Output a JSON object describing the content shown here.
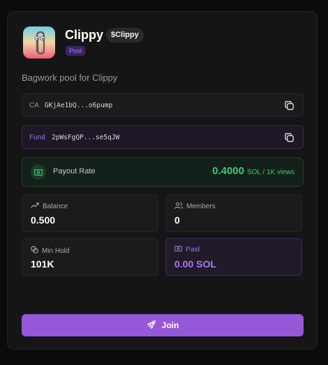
{
  "pool": {
    "name": "Clippy",
    "ticker": "$Clippy",
    "badge": "Pool",
    "description": "Bagwork pool for Clippy"
  },
  "addresses": {
    "ca_label": "CA",
    "ca_value": "GKjAe1bQ...o6pump",
    "fund_label": "Fund",
    "fund_value": "2pWsFgQP...se5qJW"
  },
  "payout": {
    "label": "Payout Rate",
    "value": "0.4000",
    "unit": "SOL / 1K views"
  },
  "stats": {
    "balance_label": "Balance",
    "balance_value": "0.500",
    "members_label": "Members",
    "members_value": "0",
    "minhold_label": "Min Hold",
    "minhold_value": "101K",
    "paid_label": "Paid",
    "paid_value": "0.00 SOL"
  },
  "actions": {
    "join_label": "Join"
  },
  "colors": {
    "accent": "#9757d9",
    "positive": "#3ecb6e",
    "background": "#151516"
  },
  "icons": [
    "clippy-logo",
    "copy-icon",
    "cash-icon",
    "trend-up-icon",
    "users-icon",
    "coins-icon",
    "rocket-icon"
  ]
}
